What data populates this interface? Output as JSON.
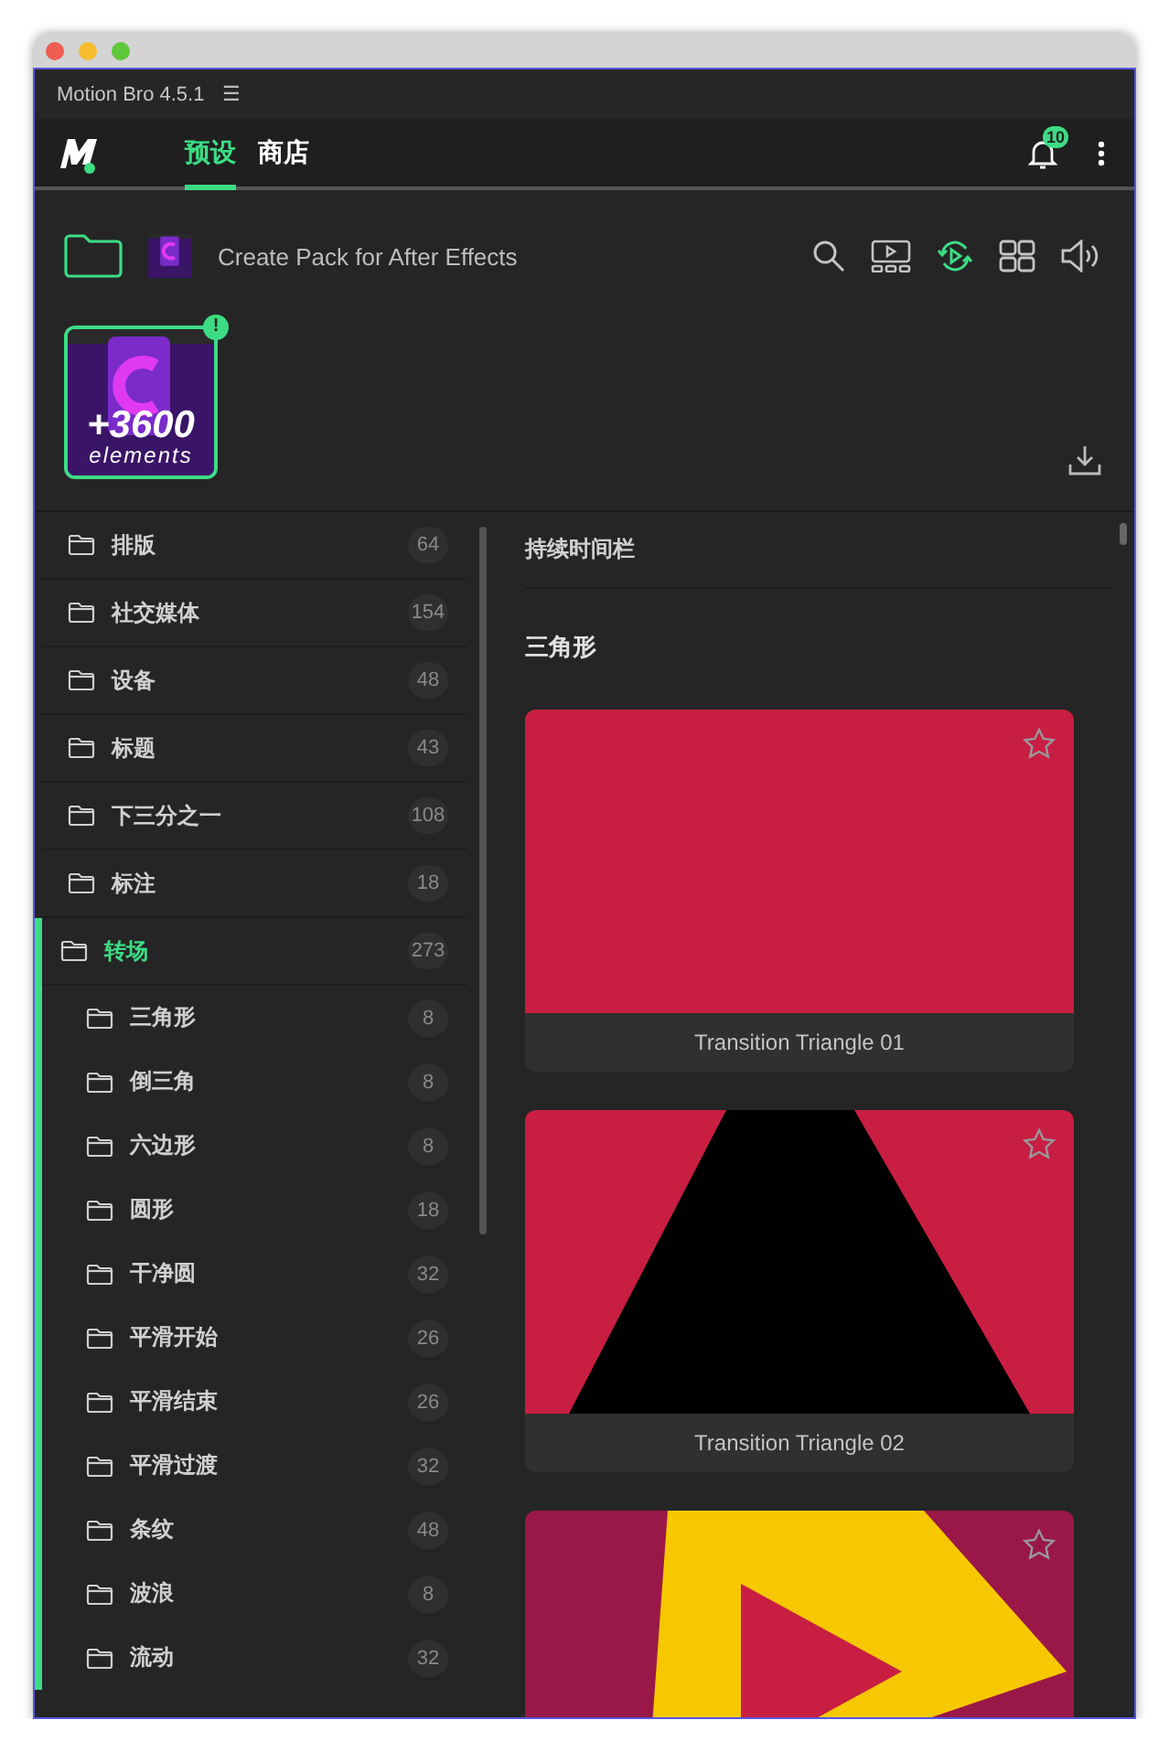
{
  "window": {
    "title": "Motion Bro 4.5.1",
    "menu_glyph": "☰"
  },
  "nav": {
    "tabs": [
      {
        "label": "预设",
        "selected": true
      },
      {
        "label": "商店",
        "selected": false
      }
    ],
    "notifications": "10"
  },
  "toolbar": {
    "pack_name": "Create Pack for After Effects",
    "tools": [
      {
        "kind": "search",
        "active": false
      },
      {
        "kind": "preview",
        "active": false
      },
      {
        "kind": "autoplay",
        "active": true
      },
      {
        "kind": "grid",
        "active": false
      },
      {
        "kind": "sound",
        "active": false
      }
    ]
  },
  "pack": {
    "headline": "+3600",
    "subline": "elements",
    "alert": "!",
    "selected": true
  },
  "sidebar": {
    "items": [
      {
        "label": "排版",
        "count": "64",
        "selected": false
      },
      {
        "label": "社交媒体",
        "count": "154",
        "selected": false
      },
      {
        "label": "设备",
        "count": "48",
        "selected": false
      },
      {
        "label": "标题",
        "count": "43",
        "selected": false
      },
      {
        "label": "下三分之一",
        "count": "108",
        "selected": false
      },
      {
        "label": "标注",
        "count": "18",
        "selected": false
      },
      {
        "label": "转场",
        "count": "273",
        "selected": true,
        "children": [
          {
            "label": "三角形",
            "count": "8",
            "selected": false
          },
          {
            "label": "倒三角",
            "count": "8",
            "selected": false
          },
          {
            "label": "六边形",
            "count": "8",
            "selected": false
          },
          {
            "label": "圆形",
            "count": "18",
            "selected": false
          },
          {
            "label": "干净圆",
            "count": "32",
            "selected": false
          },
          {
            "label": "平滑开始",
            "count": "26",
            "selected": false
          },
          {
            "label": "平滑结束",
            "count": "26",
            "selected": false
          },
          {
            "label": "平滑过渡",
            "count": "32",
            "selected": false
          },
          {
            "label": "条纹",
            "count": "48",
            "selected": false
          },
          {
            "label": "波浪",
            "count": "8",
            "selected": false
          },
          {
            "label": "流动",
            "count": "32",
            "selected": false
          }
        ]
      }
    ]
  },
  "content": {
    "filter_label": "持续时间栏",
    "section_title": "三角形",
    "cards": [
      {
        "kind": "solid",
        "title": "Transition Triangle 01",
        "favorite": false
      },
      {
        "kind": "triangle",
        "title": "Transition Triangle 02",
        "favorite": false
      },
      {
        "kind": "arrow",
        "favorite": false
      }
    ]
  }
}
